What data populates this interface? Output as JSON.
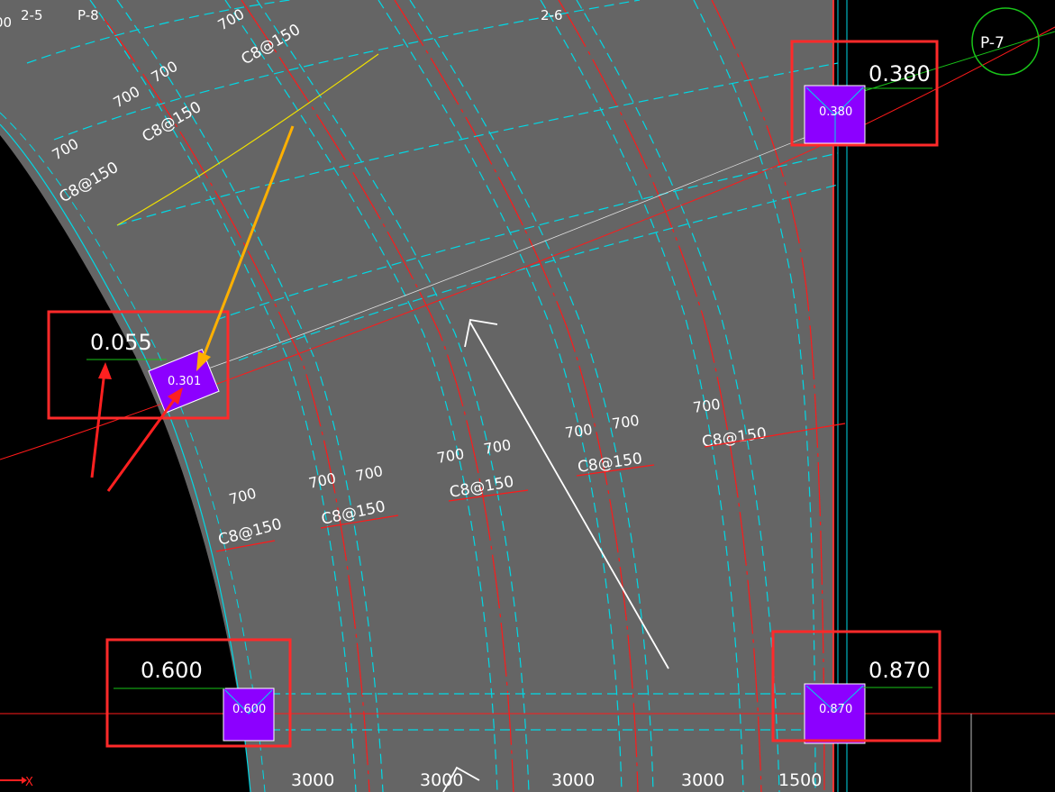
{
  "colors": {
    "background": "#000000",
    "slab": "#656565",
    "highlight_box": "#ff2a2a",
    "column": "#8c00ff",
    "dashed_beam": "#00d9e6",
    "rebar_line": "#ff1a1a",
    "annotation_arrow_orange": "#ffb000",
    "annotation_arrow_red": "#ff2020",
    "annotation_arrow_white": "#ffffff",
    "axis_green": "#19c419",
    "yellow_line": "#f0e000"
  },
  "grid_labels": {
    "g25": "2-5",
    "p8": "P-8",
    "g26": "2-6",
    "p7": "P-7"
  },
  "elevation_points": {
    "top_right": {
      "label": "0.380",
      "column_label": "0.380"
    },
    "left": {
      "label": "0.055",
      "column_label": "0.301"
    },
    "bottom_left": {
      "label": "0.600",
      "column_label": "0.600"
    },
    "bottom_right": {
      "label": "0.870",
      "column_label": "0.870"
    }
  },
  "rebar_notes": {
    "spacing": "700",
    "bar_spec": "C8@150"
  },
  "bottom_dimensions": [
    "3000",
    "3000",
    "3000",
    "3000",
    "1500"
  ],
  "axis": {
    "x_label": "X"
  },
  "edge_text": {
    "top_left_partial": "00"
  }
}
